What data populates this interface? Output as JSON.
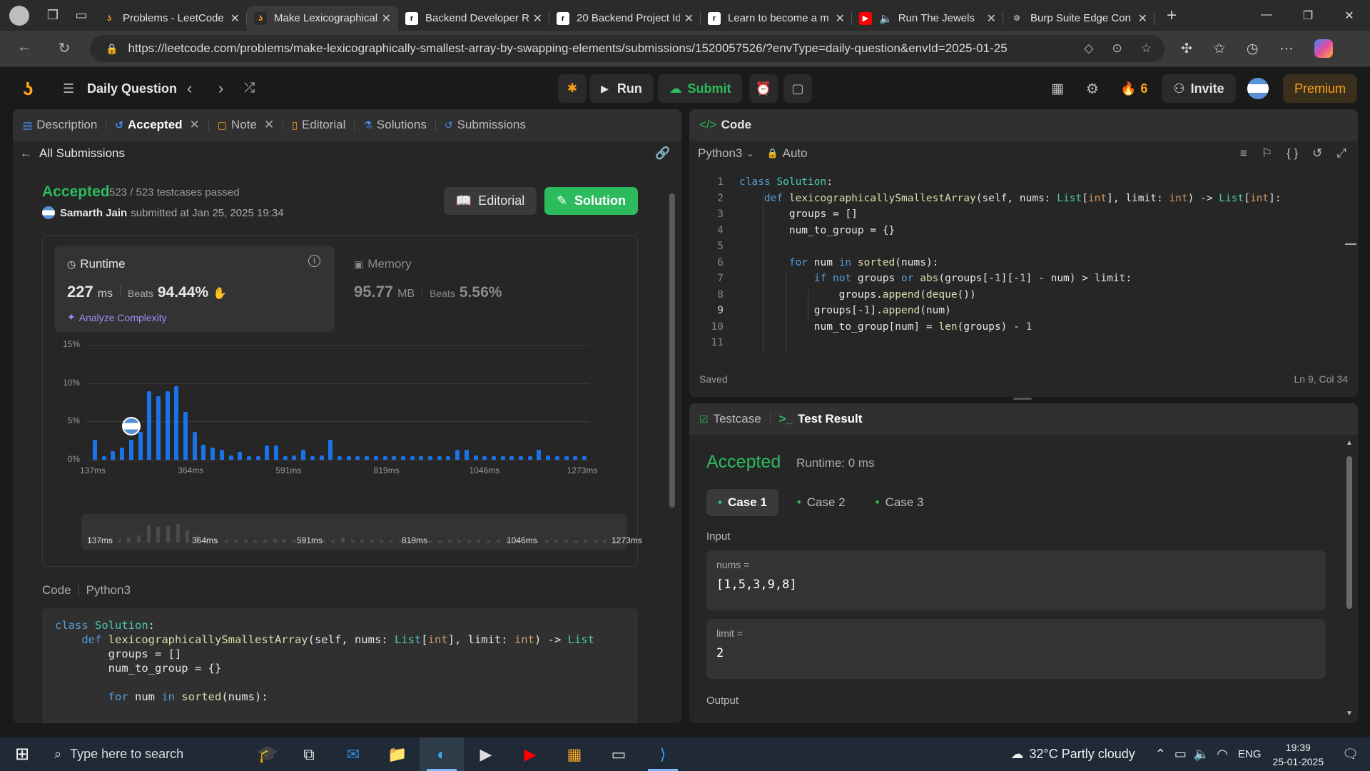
{
  "browser": {
    "tabs": [
      {
        "title": "Problems - LeetCode",
        "icon": "leetcode-icon"
      },
      {
        "title": "Make Lexicographically",
        "icon": "leetcode-icon",
        "active": true
      },
      {
        "title": "Backend Developer R",
        "icon": "roadmap-icon"
      },
      {
        "title": "20 Backend Project Id",
        "icon": "roadmap-icon"
      },
      {
        "title": "Learn to become a m",
        "icon": "roadmap-icon"
      },
      {
        "title": "Run The Jewels",
        "icon": "youtube-icon"
      },
      {
        "title": "Burp Suite Edge Con",
        "icon": "burp-icon"
      }
    ],
    "url": "https://leetcode.com/problems/make-lexicographically-smallest-array-by-swapping-elements/submissions/1520057526/?envType=daily-question&envId=2025-01-25"
  },
  "lc_nav": {
    "daily_question": "Daily Question",
    "run": "Run",
    "submit": "Submit",
    "streak": "6",
    "invite": "Invite",
    "premium": "Premium"
  },
  "left_panel": {
    "tabs": [
      "Description",
      "Accepted",
      "Note",
      "Editorial",
      "Solutions",
      "Submissions"
    ],
    "all_submissions": "All Submissions",
    "status": "Accepted",
    "testcases": "523 / 523 testcases passed",
    "user": "Samarth Jain",
    "submitted_at": "submitted at Jan 25, 2025 19:34",
    "editorial_btn": "Editorial",
    "solution_btn": "Solution",
    "runtime": {
      "label": "Runtime",
      "value": "227",
      "unit": "ms",
      "beats_label": "Beats",
      "beats": "94.44%",
      "analyze": "Analyze Complexity"
    },
    "memory": {
      "label": "Memory",
      "value": "95.77",
      "unit": "MB",
      "beats_label": "Beats",
      "beats": "5.56%"
    },
    "code_label": "Code",
    "code_lang": "Python3"
  },
  "chart_data": {
    "type": "bar",
    "title": "",
    "xlabel": "",
    "ylabel": "",
    "ylim": [
      0,
      15
    ],
    "y_ticks": [
      "15%",
      "10%",
      "5%",
      "0%"
    ],
    "x_ticks": [
      "137ms",
      "364ms",
      "591ms",
      "819ms",
      "1046ms",
      "1273ms"
    ],
    "values": [
      2.6,
      0.5,
      1.1,
      1.6,
      2.6,
      3.6,
      8.9,
      8.3,
      8.9,
      9.6,
      6.2,
      3.6,
      2.0,
      1.6,
      1.3,
      0.6,
      1.0,
      0.5,
      0.5,
      1.9,
      1.9,
      0.5,
      0.6,
      1.3,
      0.5,
      0.6,
      2.6,
      0.5,
      0.5,
      0.5,
      0.5,
      0.5,
      0.5,
      0.5,
      0.5,
      0.5,
      0.5,
      0.5,
      0.5,
      0.5,
      1.3,
      1.3,
      0.6,
      0.5,
      0.5,
      0.5,
      0.5,
      0.5,
      0.5,
      1.3,
      0.6,
      0.5,
      0.5,
      0.5,
      0.5
    ],
    "user_marker_index": 4,
    "grid": true
  },
  "left_code": [
    "class Solution:",
    "    def lexicographicallySmallestArray(self, nums: List[int], limit: int) -> List",
    "        groups = []",
    "        num_to_group = {}",
    "",
    "        for num in sorted(nums):"
  ],
  "editor": {
    "title": "Code",
    "lang": "Python3",
    "mode": "Auto",
    "status": "Saved",
    "cursor": "Ln 9, Col 34",
    "lines": [
      "class Solution:",
      "    def lexicographicallySmallestArray(self, nums: List[int], limit: int) -> List[int]:",
      "        groups = []",
      "        num_to_group = {}",
      "",
      "        for num in sorted(nums):",
      "            if not groups or abs(groups[-1][-1] - num) > limit:",
      "                groups.append(deque())",
      "            groups[-1].append(num)",
      "            num_to_group[num] = len(groups) - 1",
      ""
    ]
  },
  "test_panel": {
    "tabs": [
      "Testcase",
      "Test Result"
    ],
    "status": "Accepted",
    "runtime": "Runtime: 0 ms",
    "cases": [
      "Case 1",
      "Case 2",
      "Case 3"
    ],
    "input_label": "Input",
    "inputs": [
      {
        "name": "nums =",
        "value": "[1,5,3,9,8]"
      },
      {
        "name": "limit =",
        "value": "2"
      }
    ],
    "output_label": "Output"
  },
  "taskbar": {
    "search_placeholder": "Type here to search",
    "weather": "32°C  Partly cloudy",
    "lang": "ENG",
    "time": "19:39",
    "date": "25-01-2025"
  },
  "colors": {
    "accent_green": "#2cbb5d",
    "accent_orange": "#ffa116",
    "bar_blue": "#1a73e8"
  }
}
